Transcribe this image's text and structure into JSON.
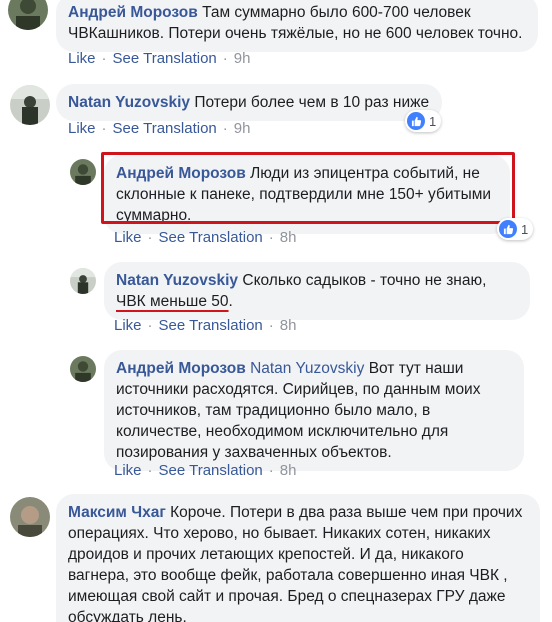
{
  "comments": [
    {
      "author": "Андрей Морозов",
      "text": "Там суммарно было 600-700 человек ЧВКашников. Потери очень тяжёлые, но не 600 человек точно.",
      "like": "Like",
      "translate": "See Translation",
      "time": "9h"
    },
    {
      "author": "Natan Yuzovskiy",
      "text": "Потери более чем в 10 раз ниже",
      "like": "Like",
      "translate": "See Translation",
      "time": "9h",
      "reactions": "1"
    },
    {
      "author": "Андрей Морозов",
      "text": "Люди из эпицентра событий, не склонные к панеке, подтвердили мне 150+ убитыми суммарно.",
      "like": "Like",
      "translate": "See Translation",
      "time": "8h",
      "reactions": "1"
    },
    {
      "author": "Natan Yuzovskiy",
      "text_before": "Сколько садыков - точно не знаю, ",
      "text_underlined": "ЧВК меньше 50",
      "text_after": ".",
      "like": "Like",
      "translate": "See Translation",
      "time": "8h"
    },
    {
      "author": "Андрей Морозов",
      "mention": "Natan Yuzovskiy",
      "text": "Вот тут наши источники расходятся. Сирийцев, по данным моих источников, там традиционно было мало, в количестве, необходимом исключительно для позирования у захваченных объектов.",
      "like": "Like",
      "translate": "See Translation",
      "time": "8h"
    },
    {
      "author": "Максим Чхаг",
      "text": "Короче. Потери в два раза выше чем при прочих операциях. Что херово, но бывает. Никаких сотен, никаких дроидов и прочих летающих крепостей. И да, никакого вагнера, это вообще фейк, работала совершенно иная ЧВК , имеющая свой сайт и прочая. Бред о спецназерах ГРУ даже обсуждать лень."
    }
  ],
  "separator": "·",
  "colors": {
    "link": "#385898",
    "muted": "#90949c",
    "bubble": "#f2f3f5",
    "highlight": "#d0141b",
    "like_blue": "#4080ff"
  }
}
